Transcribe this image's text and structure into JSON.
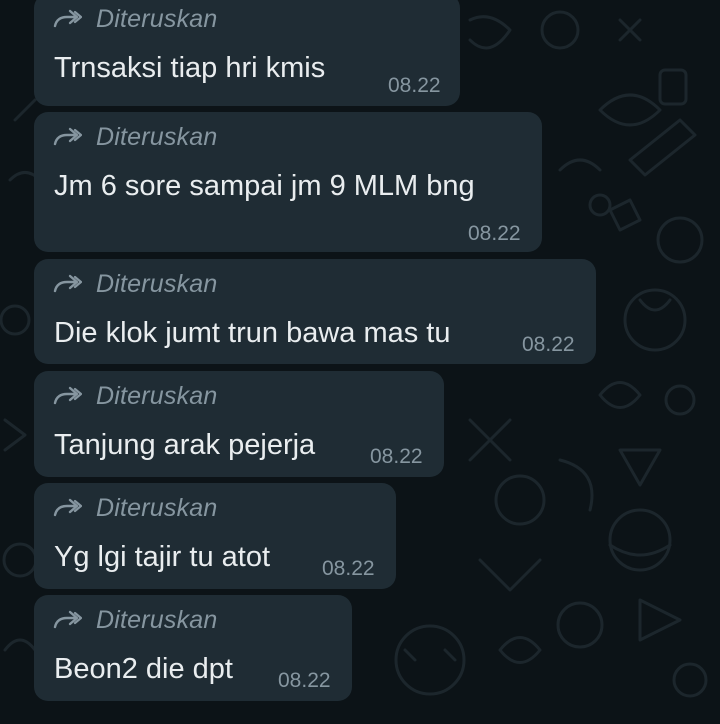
{
  "messages": [
    {
      "forwarded_label": "Diteruskan",
      "text": "Trnsaksi tiap hri kmis",
      "time": "08.22"
    },
    {
      "forwarded_label": "Diteruskan",
      "text": "Jm 6 sore sampai jm 9 MLM bng",
      "time": "08.22"
    },
    {
      "forwarded_label": "Diteruskan",
      "text": "Die klok jumt trun bawa mas tu",
      "time": "08.22"
    },
    {
      "forwarded_label": "Diteruskan",
      "text": "Tanjung arak pejerja",
      "time": "08.22"
    },
    {
      "forwarded_label": "Diteruskan",
      "text": "Yg lgi tajir tu atot",
      "time": "08.22"
    },
    {
      "forwarded_label": "Diteruskan",
      "text": "Beon2 die dpt",
      "time": "08.22"
    }
  ],
  "colors": {
    "background": "#0c1317",
    "bubble": "#1f2c34",
    "message_text": "#e9edef",
    "meta_text": "#8696a0",
    "doodle": "#1b2328"
  },
  "icons": {
    "forwarded": "forward-double-arrow-icon"
  }
}
